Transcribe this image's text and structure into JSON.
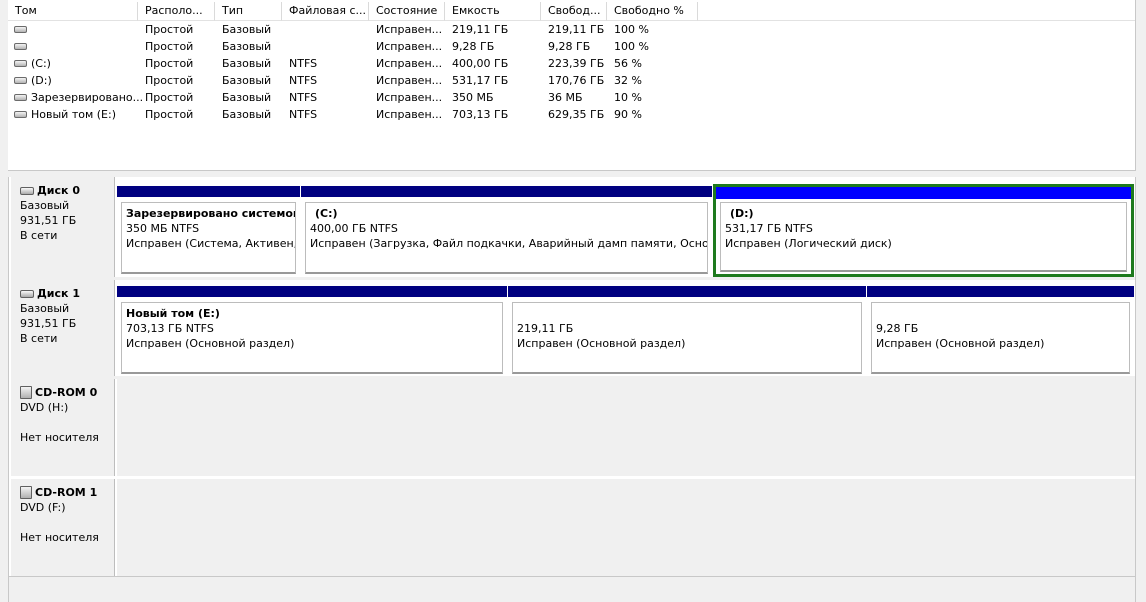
{
  "volume_list": {
    "columns": [
      "Том",
      "Располо...",
      "Тип",
      "Файловая с...",
      "Состояние",
      "Емкость",
      "Свобод...",
      "Свободно %"
    ],
    "rows": [
      [
        "",
        "Простой",
        "Базовый",
        "",
        "Исправен...",
        "219,11 ГБ",
        "219,11 ГБ",
        "100 %"
      ],
      [
        "",
        "Простой",
        "Базовый",
        "",
        "Исправен...",
        "9,28 ГБ",
        "9,28 ГБ",
        "100 %"
      ],
      [
        "(C:)",
        "Простой",
        "Базовый",
        "NTFS",
        "Исправен...",
        "400,00 ГБ",
        "223,39 ГБ",
        "56 %"
      ],
      [
        "(D:)",
        "Простой",
        "Базовый",
        "NTFS",
        "Исправен...",
        "531,17 ГБ",
        "170,76 ГБ",
        "32 %"
      ],
      [
        "Зарезервировано...",
        "Простой",
        "Базовый",
        "NTFS",
        "Исправен...",
        "350 МБ",
        "36 МБ",
        "10 %"
      ],
      [
        "Новый том (E:)",
        "Простой",
        "Базовый",
        "NTFS",
        "Исправен...",
        "703,13 ГБ",
        "629,35 ГБ",
        "90 %"
      ]
    ]
  },
  "disks": [
    {
      "title": "Диск 0",
      "type": "Базовый",
      "size": "931,51 ГБ",
      "status": "В сети",
      "partitions": [
        {
          "name": "Зарезервировано системой",
          "size": "350 МБ NTFS",
          "status": "Исправен (Система, Активен, Осно"
        },
        {
          "name": "(C:)",
          "size": "400,00 ГБ NTFS",
          "status": "Исправен (Загрузка, Файл подкачки, Аварийный дамп памяти, Основной раздел)"
        },
        {
          "name": "(D:)",
          "size": "531,17 ГБ NTFS",
          "status": "Исправен (Логический диск)"
        }
      ]
    },
    {
      "title": "Диск 1",
      "type": "Базовый",
      "size": "931,51 ГБ",
      "status": "В сети",
      "partitions": [
        {
          "name": "Новый том  (E:)",
          "size": "703,13 ГБ NTFS",
          "status": "Исправен (Основной раздел)"
        },
        {
          "name": "",
          "size": "219,11 ГБ",
          "status": "Исправен (Основной раздел)"
        },
        {
          "name": "",
          "size": "9,28 ГБ",
          "status": "Исправен (Основной раздел)"
        }
      ]
    }
  ],
  "cdroms": [
    {
      "title": "CD-ROM 0",
      "drive": "DVD (H:)",
      "status": "Нет носителя"
    },
    {
      "title": "CD-ROM 1",
      "drive": "DVD (F:)",
      "status": "Нет носителя"
    }
  ],
  "colors": {
    "primary_partition_bar": "#000080",
    "logical_partition_bar": "#0000ff",
    "selection_outline": "#1e7a1e"
  }
}
